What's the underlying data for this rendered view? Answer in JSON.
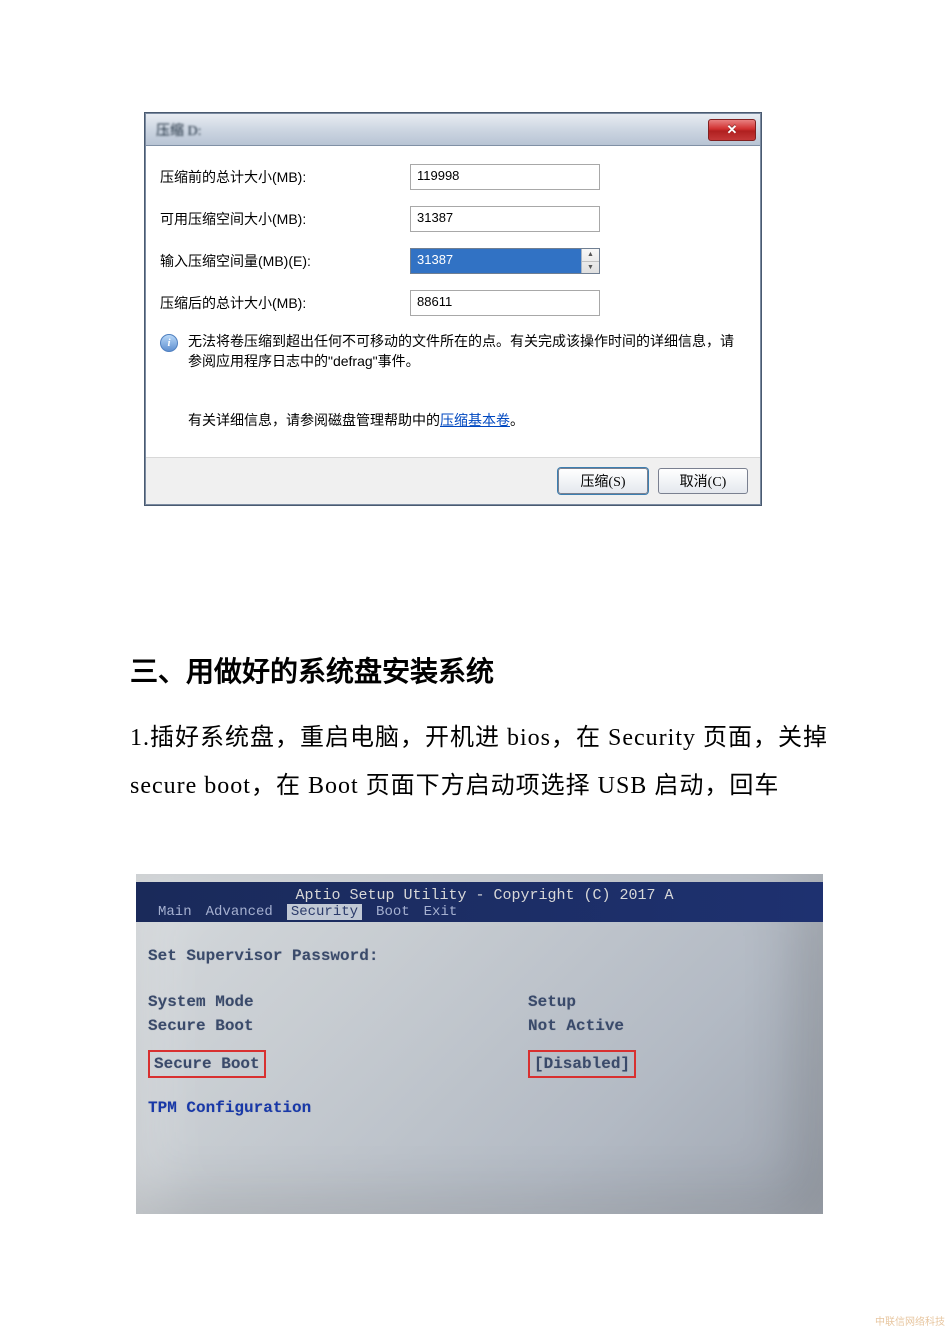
{
  "dialog": {
    "title": "压缩 D:",
    "close_glyph": "✕",
    "rows": {
      "total_before": {
        "label": "压缩前的总计大小(MB):",
        "value": "119998"
      },
      "available": {
        "label": "可用压缩空间大小(MB):",
        "value": "31387"
      },
      "input_amount": {
        "label": "输入压缩空间量(MB)(E):",
        "value": "31387"
      },
      "total_after": {
        "label": "压缩后的总计大小(MB):",
        "value": "88611"
      }
    },
    "info1": "无法将卷压缩到超出任何不可移动的文件所在的点。有关完成该操作时间的详细信息，请参阅应用程序日志中的\"defrag\"事件。",
    "info2_prefix": "有关详细信息，请参阅磁盘管理帮助中的",
    "info2_link": "压缩基本卷",
    "info2_suffix": "。",
    "btn_shrink": "压缩(S)",
    "btn_cancel": "取消(C)"
  },
  "doc": {
    "heading": "三、用做好的系统盘安装系统",
    "para": "1.插好系统盘，重启电脑，开机进 bios，在 Security 页面，关掉 secure boot，在 Boot 页面下方启动项选择 USB 启动，回车"
  },
  "bios": {
    "copyright": "Aptio Setup Utility - Copyright (C) 2017 A",
    "tabs": {
      "main": "Main",
      "advanced": "Advanced",
      "security": "Security",
      "boot": "Boot",
      "exit": "Exit"
    },
    "rows": {
      "set_supervisor": "Set Supervisor Password:",
      "system_mode": {
        "label": "System Mode",
        "value": "Setup"
      },
      "secure_boot_status": {
        "label": "Secure Boot",
        "value": "Not Active"
      },
      "secure_boot_toggle": {
        "label": "Secure Boot",
        "value": "[Disabled]"
      },
      "tpm": "TPM Configuration"
    }
  },
  "watermark": "中联信网络科技"
}
